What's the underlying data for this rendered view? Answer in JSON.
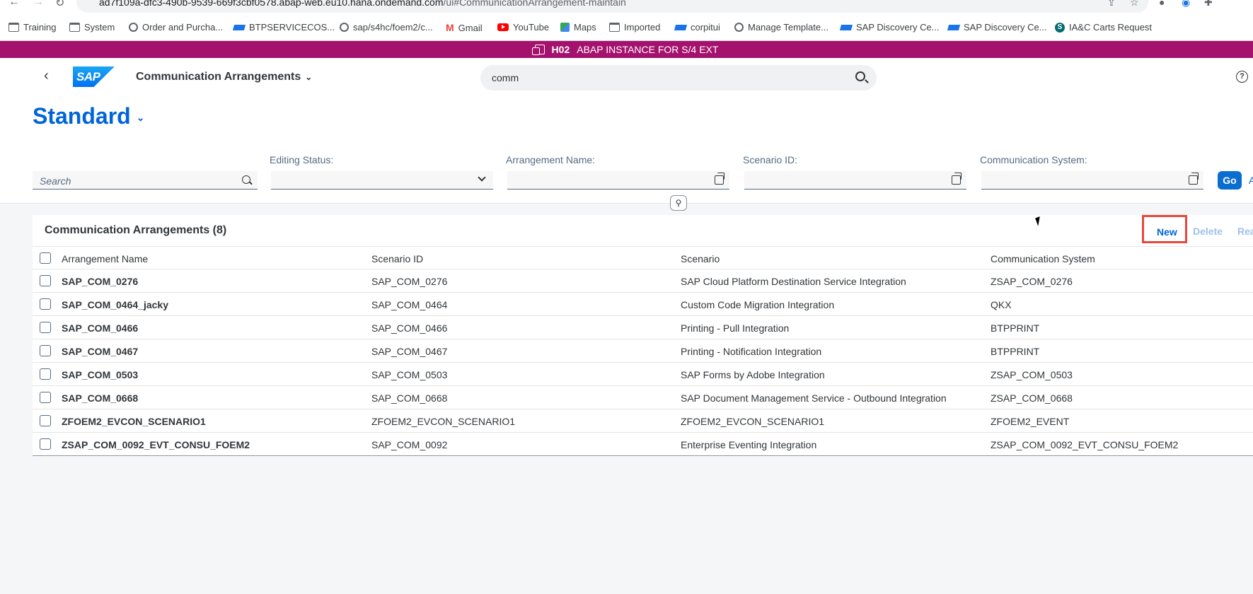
{
  "browser": {
    "url_prefix": "ad7f109a-dfc3-490b-9539-669f3cbf0578.abap-web.eu10.hana.ondemand.com",
    "url_suffix": "/ui#CommunicationArrangement-maintain",
    "bookmarks": [
      {
        "label": "Training",
        "icon": "folder-icon"
      },
      {
        "label": "System",
        "icon": "folder-icon"
      },
      {
        "label": "Order and Purcha...",
        "icon": "globe-icon"
      },
      {
        "label": "BTPSERVICECOS...",
        "icon": "sap-icon"
      },
      {
        "label": "sap/s4hc/foem2/c...",
        "icon": "globe-icon"
      },
      {
        "label": "Gmail",
        "icon": "gmail-icon"
      },
      {
        "label": "YouTube",
        "icon": "youtube-icon"
      },
      {
        "label": "Maps",
        "icon": "maps-icon"
      },
      {
        "label": "Imported",
        "icon": "folder-icon"
      },
      {
        "label": "corpitui",
        "icon": "sap-icon"
      },
      {
        "label": "Manage Template...",
        "icon": "globe-icon"
      },
      {
        "label": "SAP Discovery Ce...",
        "icon": "sap-icon"
      },
      {
        "label": "SAP Discovery Ce...",
        "icon": "sap-icon"
      },
      {
        "label": "IA&C Carts Request",
        "icon": "sharepoint-icon"
      }
    ]
  },
  "banner": {
    "system": "H02",
    "description": "ABAP INSTANCE FOR S/4 EXT",
    "color": "#a4126e"
  },
  "shell": {
    "logo_text": "SAP",
    "app_title": "Communication Arrangements",
    "search_value": "comm",
    "help_glyph": "?"
  },
  "header": {
    "variant": "Standard",
    "search_placeholder": "Search",
    "filters": [
      {
        "label": "Editing Status:",
        "value": ""
      },
      {
        "label": "Arrangement Name:",
        "value": ""
      },
      {
        "label": "Scenario ID:",
        "value": ""
      },
      {
        "label": "Communication System:",
        "value": ""
      }
    ],
    "go_label": "Go",
    "adapt_label": "A"
  },
  "table": {
    "title": "Communication Arrangements (8)",
    "actions": {
      "new": "New",
      "delete": "Delete",
      "reassign": "Rea"
    },
    "columns": [
      "Arrangement Name",
      "Scenario ID",
      "Scenario",
      "Communication System"
    ],
    "rows": [
      {
        "name": "SAP_COM_0276",
        "scenario_id": "SAP_COM_0276",
        "scenario": "SAP Cloud Platform Destination Service Integration",
        "system": "ZSAP_COM_0276"
      },
      {
        "name": "SAP_COM_0464_jacky",
        "scenario_id": "SAP_COM_0464",
        "scenario": "Custom Code Migration Integration",
        "system": "QKX"
      },
      {
        "name": "SAP_COM_0466",
        "scenario_id": "SAP_COM_0466",
        "scenario": "Printing - Pull Integration",
        "system": "BTPPRINT"
      },
      {
        "name": "SAP_COM_0467",
        "scenario_id": "SAP_COM_0467",
        "scenario": "Printing - Notification Integration",
        "system": "BTPPRINT"
      },
      {
        "name": "SAP_COM_0503",
        "scenario_id": "SAP_COM_0503",
        "scenario": "SAP Forms by Adobe Integration",
        "system": "ZSAP_COM_0503"
      },
      {
        "name": "SAP_COM_0668",
        "scenario_id": "SAP_COM_0668",
        "scenario": "SAP Document Management Service - Outbound Integration",
        "system": "ZSAP_COM_0668"
      },
      {
        "name": "ZFOEM2_EVCON_SCENARIO1",
        "scenario_id": "ZFOEM2_EVCON_SCENARIO1",
        "scenario": "ZFOEM2_EVCON_SCENARIO1",
        "system": "ZFOEM2_EVENT"
      },
      {
        "name": "ZSAP_COM_0092_EVT_CONSU_FOEM2",
        "scenario_id": "SAP_COM_0092",
        "scenario": "Enterprise Eventing Integration",
        "system": "ZSAP_COM_0092_EVT_CONSU_FOEM2"
      }
    ]
  },
  "colors": {
    "accent": "#0064d9",
    "highlight_box": "#e8473c",
    "go_button": "#0a6ed1"
  }
}
